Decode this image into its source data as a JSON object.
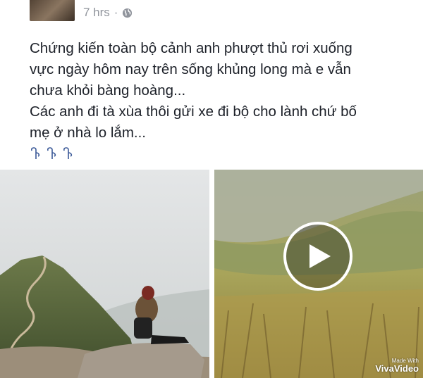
{
  "post": {
    "timestamp": "7 hrs",
    "separator": "·",
    "privacy_icon": "globe-icon",
    "text_lines": [
      "Chứng kiến toàn bộ cảnh anh phượt thủ rơi xuống",
      "vực ngày hôm nay trên sống khủng long mà e vẫn",
      "chưa khỏi bàng hoàng...",
      "Các anh đi tà xùa thôi gửi xe đi bộ cho lành chứ bố",
      "mẹ ở nhà lo lắm..."
    ],
    "emojis": [
      "pointing-down-icon",
      "pointing-down-icon",
      "pointing-down-icon"
    ]
  },
  "media": {
    "photo": {
      "description_icon": "hiker-on-ridge-photo"
    },
    "video": {
      "play_icon": "play-icon",
      "watermark_small": "Made With",
      "watermark_big": "VivaVideo"
    }
  },
  "colors": {
    "text": "#1d2129",
    "meta": "#90949c"
  }
}
